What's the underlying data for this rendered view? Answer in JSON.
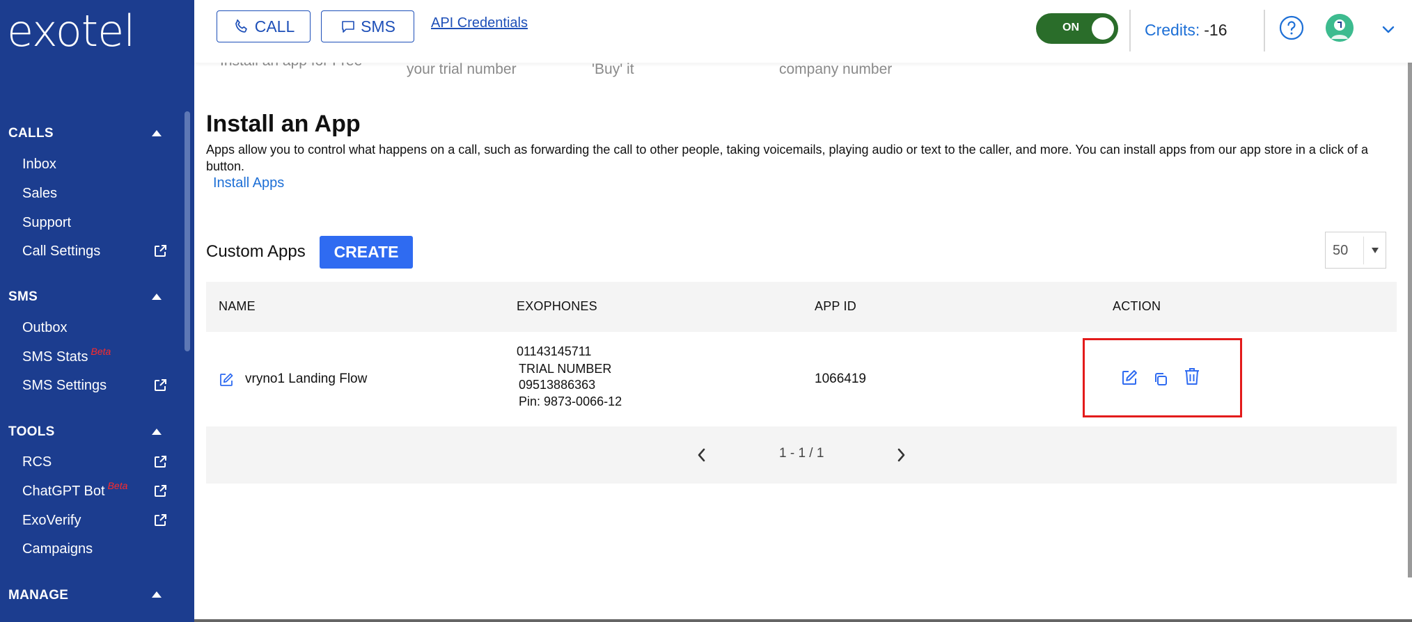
{
  "brand": {
    "logo": "exotel"
  },
  "sidebar": {
    "sections": [
      {
        "title": "CALLS",
        "items": [
          {
            "label": "Inbox",
            "external": false,
            "beta": ""
          },
          {
            "label": "Sales",
            "external": false,
            "beta": ""
          },
          {
            "label": "Support",
            "external": false,
            "beta": ""
          },
          {
            "label": "Call Settings",
            "external": true,
            "beta": ""
          }
        ]
      },
      {
        "title": "SMS",
        "items": [
          {
            "label": "Outbox",
            "external": false,
            "beta": ""
          },
          {
            "label": "SMS Stats",
            "external": false,
            "beta": "Beta"
          },
          {
            "label": "SMS Settings",
            "external": true,
            "beta": ""
          }
        ]
      },
      {
        "title": "TOOLS",
        "items": [
          {
            "label": "RCS",
            "external": true,
            "beta": ""
          },
          {
            "label": "ChatGPT Bot",
            "external": true,
            "beta": "Beta"
          },
          {
            "label": "ExoVerify",
            "external": true,
            "beta": ""
          },
          {
            "label": "Campaigns",
            "external": false,
            "beta": ""
          }
        ]
      },
      {
        "title": "MANAGE",
        "items": []
      }
    ]
  },
  "topbar": {
    "call_label": "CALL",
    "sms_label": "SMS",
    "api_link": "API Credentials",
    "toggle_label": "ON",
    "credits_label": "Credits:",
    "credits_value": "-16"
  },
  "steps_faded": {
    "s1": "Install an app for Free",
    "s2": "your trial number",
    "s3": "'Buy' it",
    "s4": "company number"
  },
  "install": {
    "title": "Install an App",
    "description": "Apps allow you to control what happens on a call, such as forwarding the call to other people, taking voicemails, playing audio or text to the caller, and more. You can install apps from our app store in a click of a button.",
    "link": "Install Apps"
  },
  "custom_apps": {
    "title": "Custom Apps",
    "create_label": "CREATE",
    "page_size": "50",
    "columns": [
      "NAME",
      "EXOPHONES",
      "APP ID",
      "ACTION"
    ],
    "rows": [
      {
        "name": "vryno1 Landing Flow",
        "exophone": "01143145711",
        "trial_label": "TRIAL NUMBER",
        "trial_number": "09513886363",
        "pin": "Pin: 9873-0066-12",
        "app_id": "1066419"
      }
    ],
    "pagination": "1 - 1 / 1"
  },
  "colors": {
    "sidebar": "#1c3d8f",
    "accent": "#2f6bf1",
    "toggle_on": "#2a6d2a",
    "highlight": "#e31b1b"
  }
}
